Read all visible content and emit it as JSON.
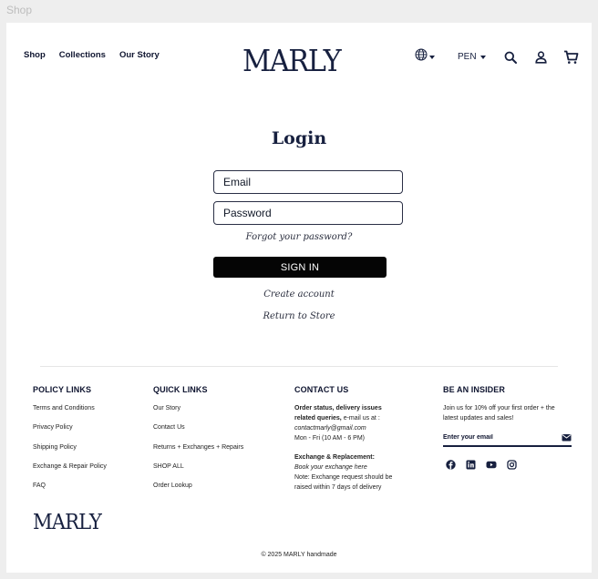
{
  "window": {
    "title": "Shop"
  },
  "header": {
    "nav": [
      {
        "label": "Shop",
        "name": "nav-shop"
      },
      {
        "label": "Collections",
        "name": "nav-collections"
      },
      {
        "label": "Our Story",
        "name": "nav-our-story"
      }
    ],
    "logo": "MARLY",
    "currency": "PEN",
    "icons": [
      "globe-icon",
      "chevron-down-icon",
      "search-icon",
      "user-icon",
      "cart-icon"
    ]
  },
  "login": {
    "title": "Login",
    "email_placeholder": "Email",
    "password_placeholder": "Password",
    "forgot": "Forgot your password?",
    "sign_in": "SIGN IN",
    "create_account": "Create account",
    "return_to_store": "Return to Store"
  },
  "footer": {
    "policy": {
      "heading": "POLICY LINKS",
      "links": [
        "Terms and Conditions",
        "Privacy Policy",
        "Shipping Policy",
        "Exchange & Repair Policy",
        "FAQ"
      ]
    },
    "quick": {
      "heading": "QUICK LINKS",
      "links": [
        "Our Story",
        "Contact Us",
        "Returns + Exchanges + Repairs",
        "SHOP ALL",
        "Order Lookup"
      ]
    },
    "contact": {
      "heading": "CONTACT US",
      "status_bold_1": "Order status, delivery issues",
      "status_bold_2": "related queries,",
      "status_rest": " e-mail us at :",
      "email": "contactmarly@gmail.com",
      "hours": "Mon - Fri (10 AM - 6 PM)",
      "exchange_heading": "Exchange & Replacement:",
      "exchange_link": "Book your exchange here",
      "note_1": "Note: Exchange request should be",
      "note_2": "raised within 7 days of delivery"
    },
    "insider": {
      "heading": "BE AN INSIDER",
      "text": "Join us for 10% off your first order + the latest updates and sales!",
      "email_placeholder": "Enter your email",
      "socials": [
        "facebook-icon",
        "linkedin-icon",
        "youtube-icon",
        "instagram-icon"
      ]
    },
    "logo": "MARLY",
    "copyright": "© 2025 MARLY handmade"
  },
  "colors": {
    "navy": "#17203f",
    "button": "#050505",
    "background": "#eeeeee"
  }
}
